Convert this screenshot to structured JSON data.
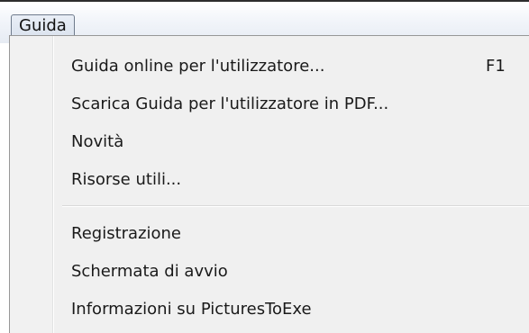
{
  "menubar": {
    "title": "Guida"
  },
  "menu": {
    "group1": [
      {
        "label": "Guida online per l'utilizzatore...",
        "shortcut": "F1"
      },
      {
        "label": "Scarica Guida per l'utilizzatore in PDF...",
        "shortcut": ""
      },
      {
        "label": "Novità",
        "shortcut": ""
      },
      {
        "label": "Risorse utili...",
        "shortcut": ""
      }
    ],
    "group2": [
      {
        "label": "Registrazione",
        "shortcut": ""
      },
      {
        "label": "Schermata di avvio",
        "shortcut": ""
      },
      {
        "label": "Informazioni su PicturesToExe",
        "shortcut": ""
      }
    ]
  }
}
